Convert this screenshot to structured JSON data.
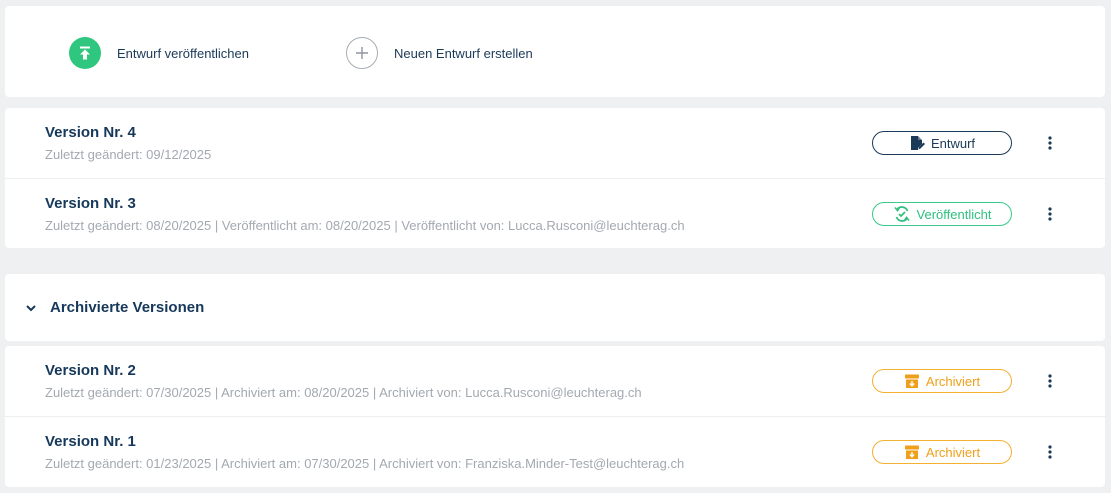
{
  "toolbar": {
    "publish_label": "Entwurf veröffentlichen",
    "new_draft_label": "Neuen Entwurf erstellen"
  },
  "active_versions": [
    {
      "title": "Version Nr. 4",
      "meta": "Zuletzt geändert: 09/12/2025",
      "status": "Entwurf"
    },
    {
      "title": "Version Nr. 3",
      "meta": "Zuletzt geändert: 08/20/2025 | Veröffentlicht am: 08/20/2025 | Veröffentlicht von: Lucca.Rusconi@leuchterag.ch",
      "status": "Veröffentlicht"
    }
  ],
  "archived": {
    "header": "Archivierte Versionen",
    "versions": [
      {
        "title": "Version Nr. 2",
        "meta": "Zuletzt geändert: 07/30/2025 | Archiviert am: 08/20/2025 | Archiviert von: Lucca.Rusconi@leuchterag.ch",
        "status": "Archiviert"
      },
      {
        "title": "Version Nr. 1",
        "meta": "Zuletzt geändert: 01/23/2025 | Archiviert am: 07/30/2025 | Archiviert von: Franziska.Minder-Test@leuchterag.ch",
        "status": "Archiviert"
      }
    ]
  },
  "colors": {
    "primary_text": "#16385a",
    "muted_text": "#a3a9b0",
    "published_green": "#2fc780",
    "archived_orange": "#f3b132"
  },
  "icons": {
    "publish": "upload-arrow-icon",
    "new": "plus-icon",
    "draft": "edit-document-icon",
    "published": "refresh-check-icon",
    "archived": "archive-box-icon",
    "more": "kebab-menu-icon",
    "collapse": "chevron-down-icon"
  }
}
